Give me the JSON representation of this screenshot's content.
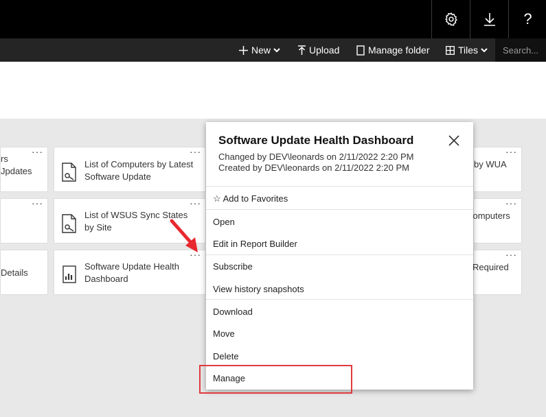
{
  "topbar": {
    "icons": [
      "gear-icon",
      "download-icon",
      "help-icon"
    ],
    "help_glyph": "?"
  },
  "toolbar": {
    "new_label": "New",
    "upload_label": "Upload",
    "manage_folder_label": "Manage folder",
    "tiles_label": "Tiles",
    "search_placeholder": "Search..."
  },
  "tiles": [
    {
      "name": "rs\nUpdates",
      "row": 1,
      "col": 0
    },
    {
      "name": "List of Computers by Latest\nSoftware Update",
      "row": 1,
      "col": 1
    },
    {
      "name": "by WUA",
      "row": 1,
      "col": 3
    },
    {
      "name": "",
      "row": 2,
      "col": 0
    },
    {
      "name": "List of WSUS Sync States\nby Site",
      "row": 2,
      "col": 1
    },
    {
      "name": "computers",
      "row": 2,
      "col": 3
    },
    {
      "name": "Details",
      "row": 3,
      "col": 0
    },
    {
      "name": "Software Update Health\nDashboard",
      "row": 3,
      "col": 1
    },
    {
      "name": "Required",
      "row": 3,
      "col": 3
    }
  ],
  "popup": {
    "title": "Software Update Health Dashboard",
    "changed": "Changed by DEV\\leonards on 2/11/2022 2:20 PM",
    "created": "Created by DEV\\leonards on 2/11/2022 2:20 PM",
    "favorites_label": "Add to Favorites",
    "favorites_glyph": "☆",
    "menu": [
      "Open",
      "Edit in Report Builder",
      "Subscribe",
      "View history snapshots",
      "Download",
      "Move",
      "Delete",
      "Manage"
    ]
  },
  "colors": {
    "topbar": "#000000",
    "toolbar": "#252525",
    "content_bg": "#e8e8e8",
    "highlight": "#e0393e",
    "arrow": "#e8282e"
  }
}
